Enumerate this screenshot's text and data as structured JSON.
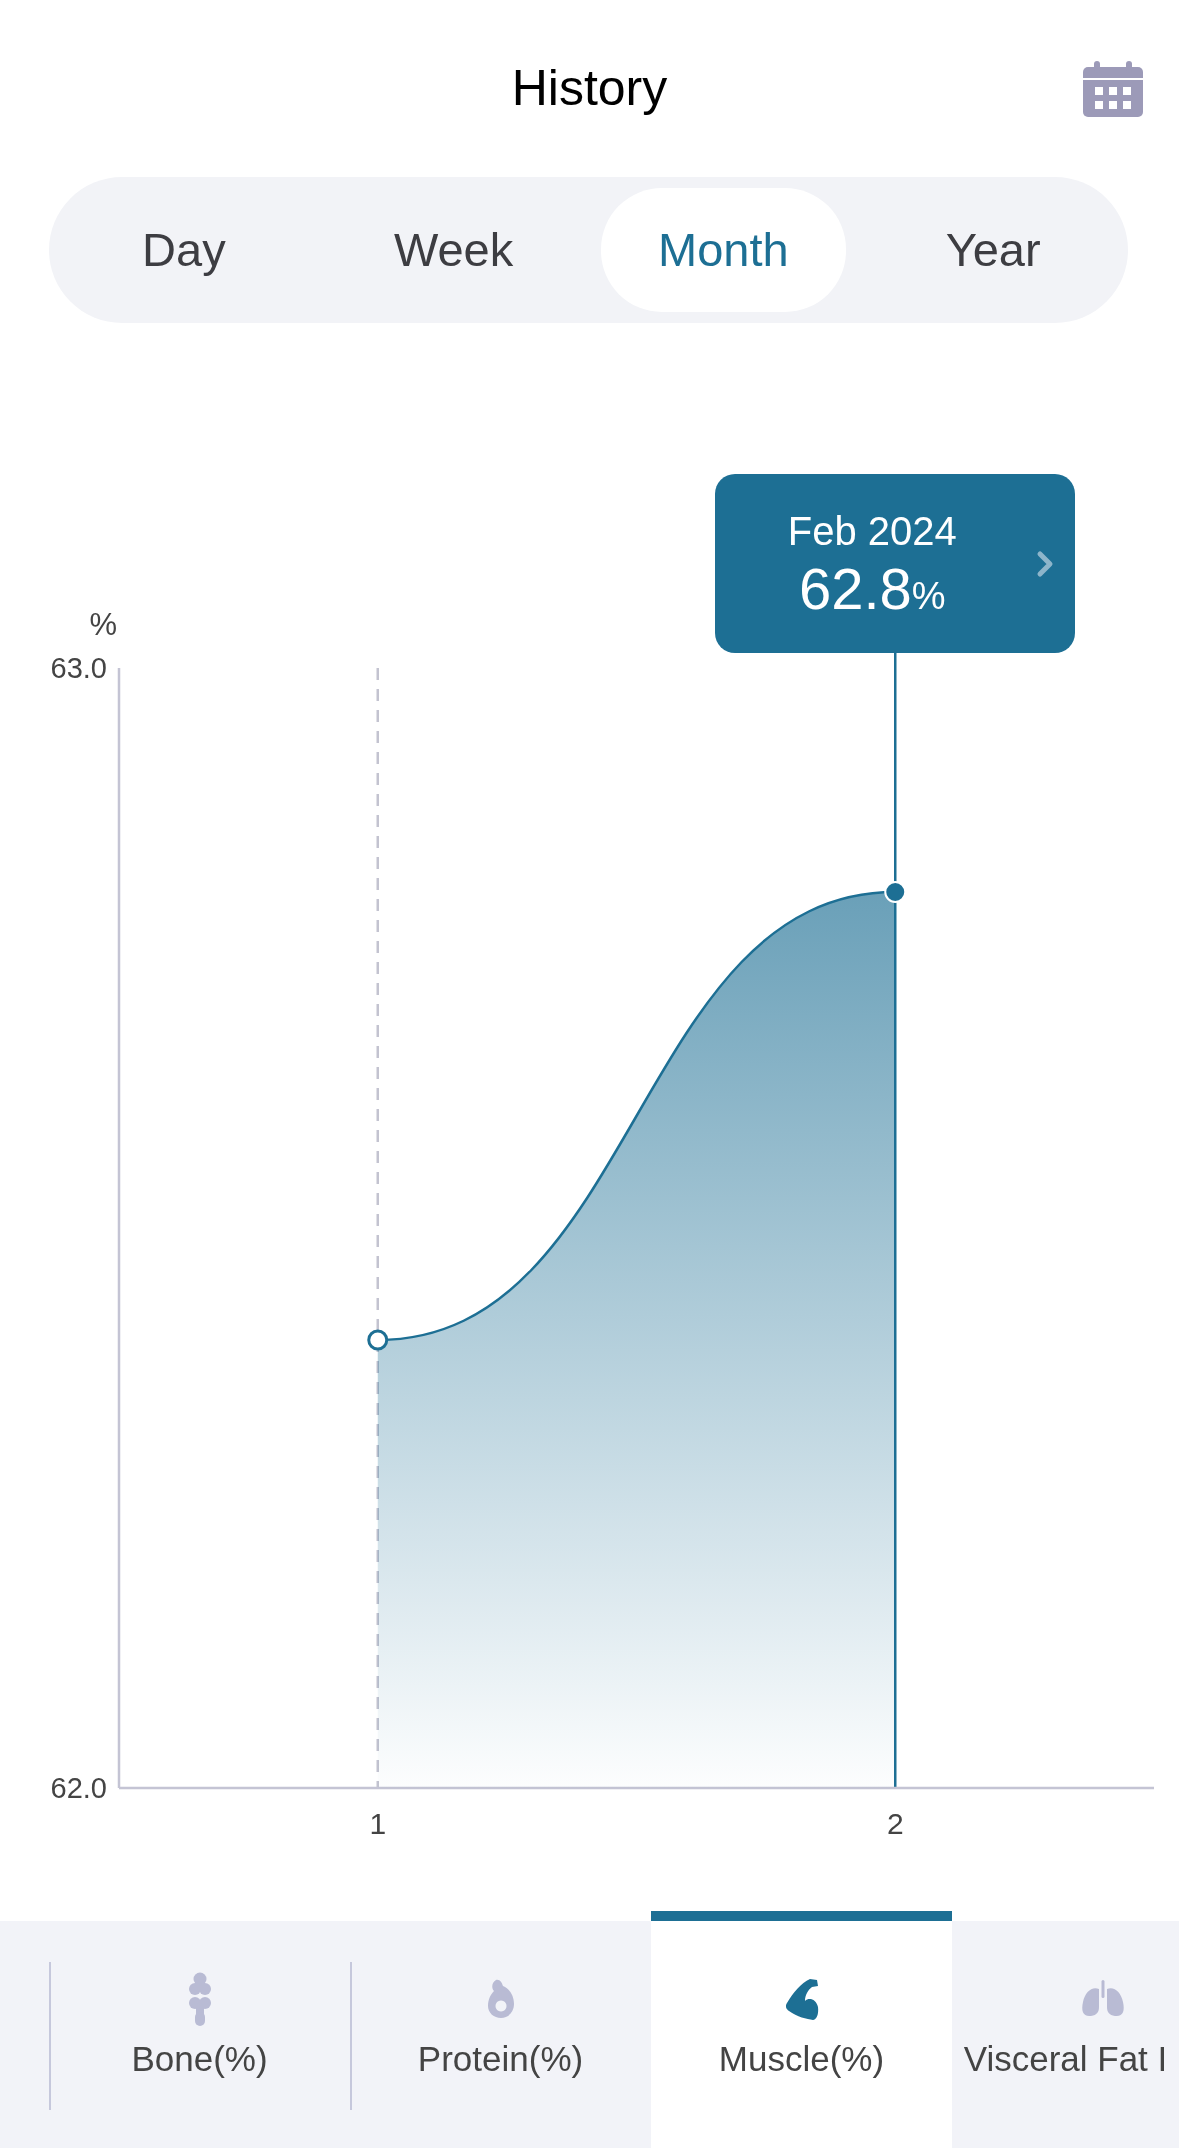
{
  "header": {
    "title": "History"
  },
  "periods": [
    {
      "label": "Day",
      "selected": false
    },
    {
      "label": "Week",
      "selected": false
    },
    {
      "label": "Month",
      "selected": true
    },
    {
      "label": "Year",
      "selected": false
    }
  ],
  "chart": {
    "points": [
      {
        "selected": false
      },
      {
        "selected": true
      }
    ],
    "tooltip": {
      "date": "Feb 2024",
      "value": "62.8",
      "unit": "%"
    },
    "chart_data": {
      "type": "area",
      "ylabel": "%",
      "x": [
        1,
        2
      ],
      "series": [
        {
          "color": "#1d6f94",
          "values": [
            62.4,
            62.8
          ]
        }
      ],
      "xlim": [
        0.5,
        2.5
      ],
      "ylim": [
        62,
        63
      ],
      "xticks": [
        1,
        2
      ],
      "yticks": [
        {
          "value": 62,
          "label": "62.0"
        },
        {
          "value": 63,
          "label": "63.0"
        }
      ],
      "ref_lines": [
        {
          "axis": "x",
          "value": 1
        },
        {
          "axis": "x",
          "value": 2
        }
      ]
    }
  },
  "metric_tabs": [
    {
      "kind": "bone",
      "label": "Bone(%)",
      "selected": false
    },
    {
      "kind": "protein",
      "label": "Protein(%)",
      "selected": false
    },
    {
      "kind": "muscle",
      "label": "Muscle(%)",
      "selected": true
    },
    {
      "kind": "lungs",
      "label": "Visceral Fat I",
      "selected": false
    }
  ]
}
